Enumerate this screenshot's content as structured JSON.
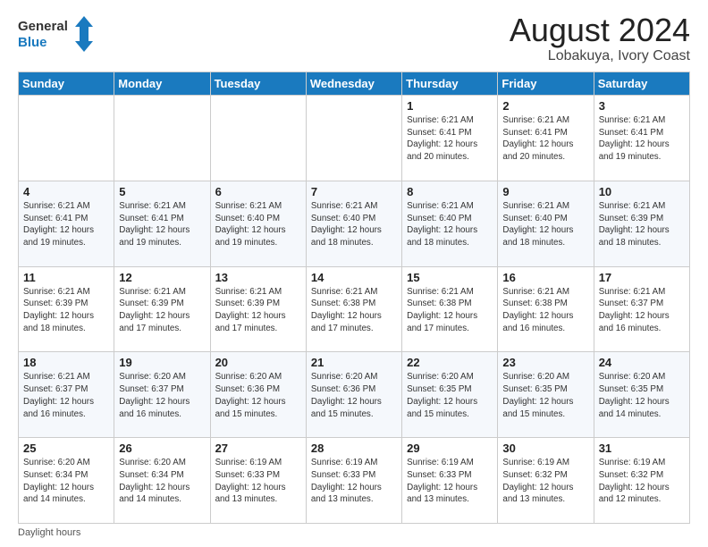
{
  "logo": {
    "line1": "General",
    "line2": "Blue"
  },
  "title": "August 2024",
  "subtitle": "Lobakuya, Ivory Coast",
  "weekdays": [
    "Sunday",
    "Monday",
    "Tuesday",
    "Wednesday",
    "Thursday",
    "Friday",
    "Saturday"
  ],
  "weeks": [
    [
      {
        "day": "",
        "detail": ""
      },
      {
        "day": "",
        "detail": ""
      },
      {
        "day": "",
        "detail": ""
      },
      {
        "day": "",
        "detail": ""
      },
      {
        "day": "1",
        "detail": "Sunrise: 6:21 AM\nSunset: 6:41 PM\nDaylight: 12 hours\nand 20 minutes."
      },
      {
        "day": "2",
        "detail": "Sunrise: 6:21 AM\nSunset: 6:41 PM\nDaylight: 12 hours\nand 20 minutes."
      },
      {
        "day": "3",
        "detail": "Sunrise: 6:21 AM\nSunset: 6:41 PM\nDaylight: 12 hours\nand 19 minutes."
      }
    ],
    [
      {
        "day": "4",
        "detail": "Sunrise: 6:21 AM\nSunset: 6:41 PM\nDaylight: 12 hours\nand 19 minutes."
      },
      {
        "day": "5",
        "detail": "Sunrise: 6:21 AM\nSunset: 6:41 PM\nDaylight: 12 hours\nand 19 minutes."
      },
      {
        "day": "6",
        "detail": "Sunrise: 6:21 AM\nSunset: 6:40 PM\nDaylight: 12 hours\nand 19 minutes."
      },
      {
        "day": "7",
        "detail": "Sunrise: 6:21 AM\nSunset: 6:40 PM\nDaylight: 12 hours\nand 18 minutes."
      },
      {
        "day": "8",
        "detail": "Sunrise: 6:21 AM\nSunset: 6:40 PM\nDaylight: 12 hours\nand 18 minutes."
      },
      {
        "day": "9",
        "detail": "Sunrise: 6:21 AM\nSunset: 6:40 PM\nDaylight: 12 hours\nand 18 minutes."
      },
      {
        "day": "10",
        "detail": "Sunrise: 6:21 AM\nSunset: 6:39 PM\nDaylight: 12 hours\nand 18 minutes."
      }
    ],
    [
      {
        "day": "11",
        "detail": "Sunrise: 6:21 AM\nSunset: 6:39 PM\nDaylight: 12 hours\nand 18 minutes."
      },
      {
        "day": "12",
        "detail": "Sunrise: 6:21 AM\nSunset: 6:39 PM\nDaylight: 12 hours\nand 17 minutes."
      },
      {
        "day": "13",
        "detail": "Sunrise: 6:21 AM\nSunset: 6:39 PM\nDaylight: 12 hours\nand 17 minutes."
      },
      {
        "day": "14",
        "detail": "Sunrise: 6:21 AM\nSunset: 6:38 PM\nDaylight: 12 hours\nand 17 minutes."
      },
      {
        "day": "15",
        "detail": "Sunrise: 6:21 AM\nSunset: 6:38 PM\nDaylight: 12 hours\nand 17 minutes."
      },
      {
        "day": "16",
        "detail": "Sunrise: 6:21 AM\nSunset: 6:38 PM\nDaylight: 12 hours\nand 16 minutes."
      },
      {
        "day": "17",
        "detail": "Sunrise: 6:21 AM\nSunset: 6:37 PM\nDaylight: 12 hours\nand 16 minutes."
      }
    ],
    [
      {
        "day": "18",
        "detail": "Sunrise: 6:21 AM\nSunset: 6:37 PM\nDaylight: 12 hours\nand 16 minutes."
      },
      {
        "day": "19",
        "detail": "Sunrise: 6:20 AM\nSunset: 6:37 PM\nDaylight: 12 hours\nand 16 minutes."
      },
      {
        "day": "20",
        "detail": "Sunrise: 6:20 AM\nSunset: 6:36 PM\nDaylight: 12 hours\nand 15 minutes."
      },
      {
        "day": "21",
        "detail": "Sunrise: 6:20 AM\nSunset: 6:36 PM\nDaylight: 12 hours\nand 15 minutes."
      },
      {
        "day": "22",
        "detail": "Sunrise: 6:20 AM\nSunset: 6:35 PM\nDaylight: 12 hours\nand 15 minutes."
      },
      {
        "day": "23",
        "detail": "Sunrise: 6:20 AM\nSunset: 6:35 PM\nDaylight: 12 hours\nand 15 minutes."
      },
      {
        "day": "24",
        "detail": "Sunrise: 6:20 AM\nSunset: 6:35 PM\nDaylight: 12 hours\nand 14 minutes."
      }
    ],
    [
      {
        "day": "25",
        "detail": "Sunrise: 6:20 AM\nSunset: 6:34 PM\nDaylight: 12 hours\nand 14 minutes."
      },
      {
        "day": "26",
        "detail": "Sunrise: 6:20 AM\nSunset: 6:34 PM\nDaylight: 12 hours\nand 14 minutes."
      },
      {
        "day": "27",
        "detail": "Sunrise: 6:19 AM\nSunset: 6:33 PM\nDaylight: 12 hours\nand 13 minutes."
      },
      {
        "day": "28",
        "detail": "Sunrise: 6:19 AM\nSunset: 6:33 PM\nDaylight: 12 hours\nand 13 minutes."
      },
      {
        "day": "29",
        "detail": "Sunrise: 6:19 AM\nSunset: 6:33 PM\nDaylight: 12 hours\nand 13 minutes."
      },
      {
        "day": "30",
        "detail": "Sunrise: 6:19 AM\nSunset: 6:32 PM\nDaylight: 12 hours\nand 13 minutes."
      },
      {
        "day": "31",
        "detail": "Sunrise: 6:19 AM\nSunset: 6:32 PM\nDaylight: 12 hours\nand 12 minutes."
      }
    ]
  ],
  "footer": "Daylight hours"
}
